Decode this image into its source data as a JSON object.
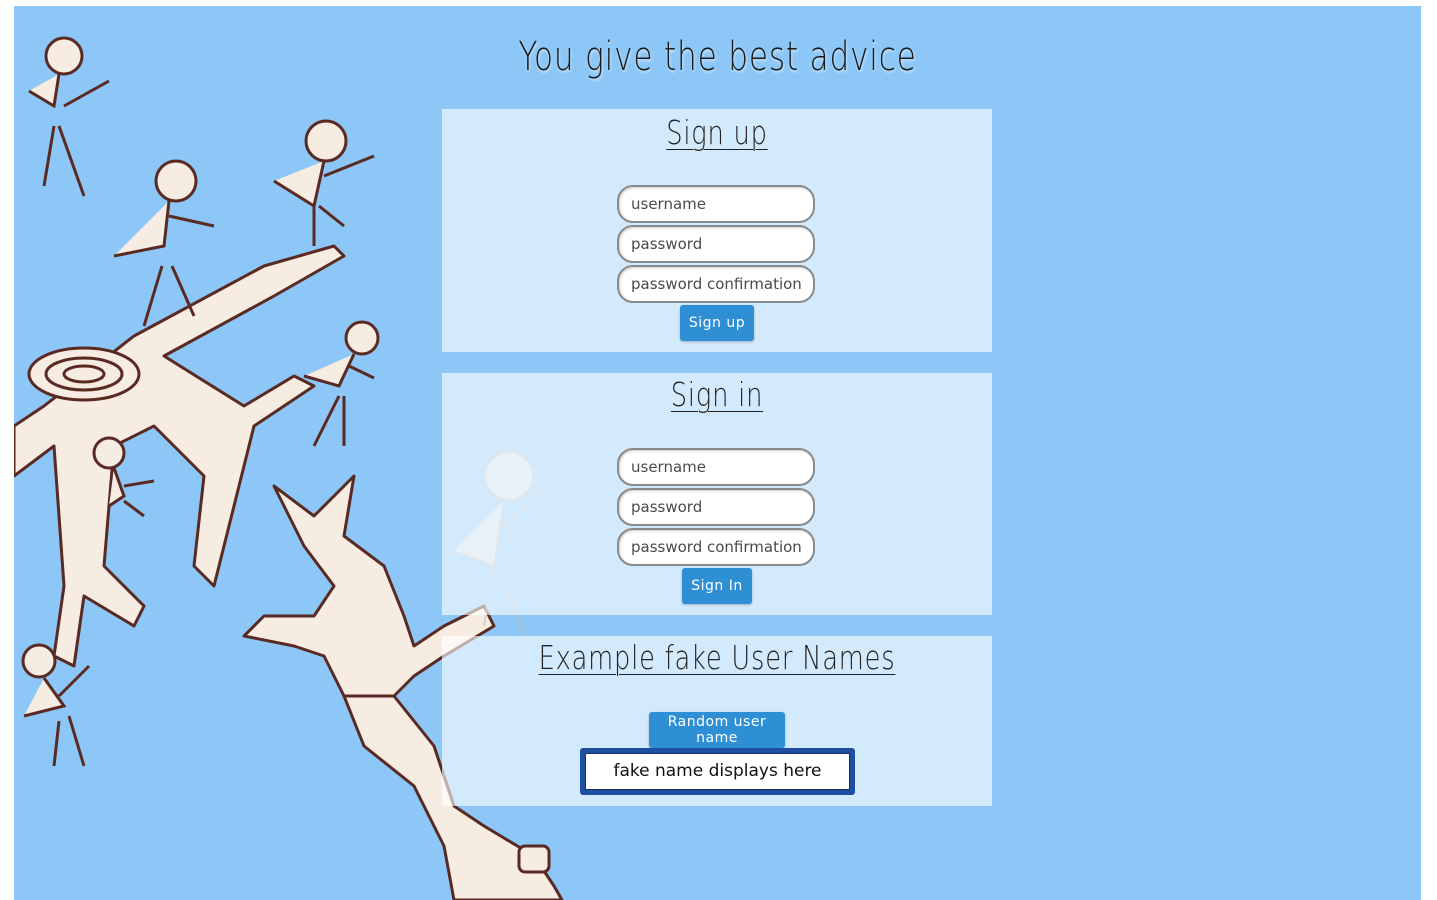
{
  "page": {
    "title": "You give the best advice"
  },
  "signup": {
    "heading": "Sign up",
    "username_placeholder": "username",
    "password_placeholder": "password",
    "confirm_placeholder": "password confirmation",
    "button_label": "Sign up"
  },
  "signin": {
    "heading": "Sign in",
    "username_placeholder": "username",
    "password_placeholder": "password",
    "confirm_placeholder": "password confirmation",
    "button_label": "Sign In"
  },
  "examples": {
    "heading": "Example fake User Names",
    "button_label": "Random user name",
    "display_text": "fake name displays here"
  },
  "colors": {
    "background": "#8cc7f7",
    "button": "#2e8fd4",
    "namebox_border": "#1f4fa0"
  }
}
